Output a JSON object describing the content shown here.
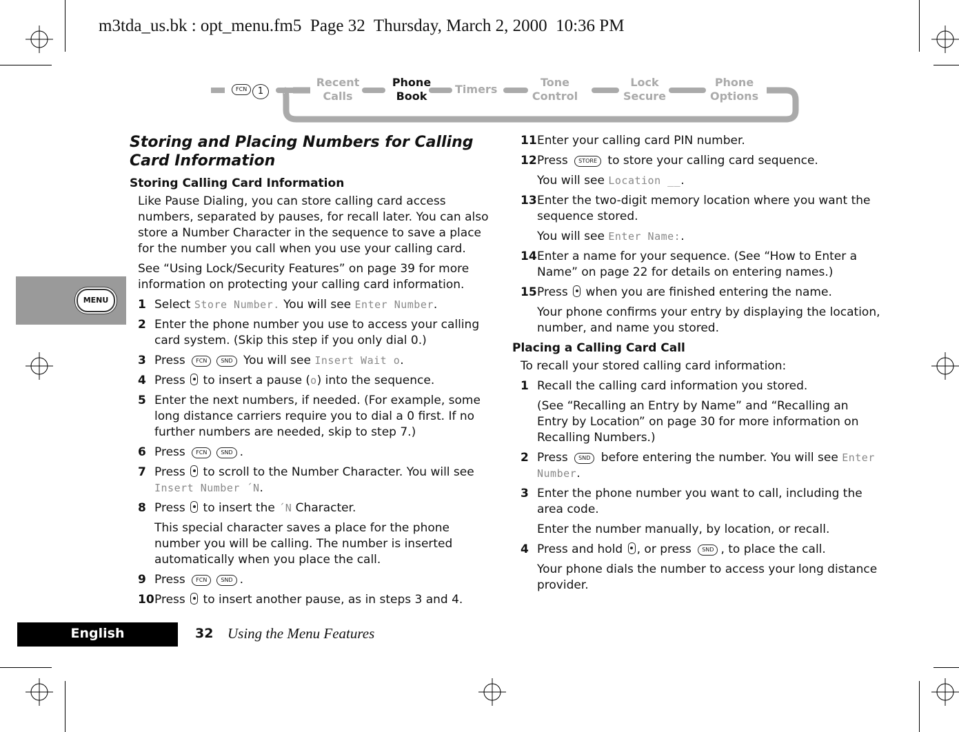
{
  "slug": "m3tda_us.bk : opt_menu.fm5  Page 32  Thursday, March 2, 2000  10:36 PM",
  "nav": {
    "prefix_keys": [
      "FCN",
      "1"
    ],
    "items": [
      {
        "label": "Recent\nCalls",
        "active": false
      },
      {
        "label": "Phone\nBook",
        "active": true
      },
      {
        "label": "Timers",
        "active": false
      },
      {
        "label": "Tone\nControl",
        "active": false
      },
      {
        "label": "Lock\nSecure",
        "active": false
      },
      {
        "label": "Phone\nOptions",
        "active": false
      }
    ]
  },
  "side_tab": {
    "label": "MENU"
  },
  "left": {
    "title": "Storing and Placing Numbers for Calling Card Information",
    "section": "Storing Calling Card Information",
    "intro": [
      "Like Pause Dialing, you can store calling card access numbers, separated by pauses, for recall later. You can also store a Number Character in the sequence to save a place for the number you call when you use your calling card.",
      "See “Using Lock/Security Features” on page 39 for more information on protecting your calling card information."
    ],
    "steps": [
      {
        "n": "1",
        "parts": [
          {
            "t": "Select "
          },
          {
            "lcd": "Store Number."
          },
          {
            "t": " You will see "
          },
          {
            "lcd": "Enter Number"
          },
          {
            "t": "."
          }
        ]
      },
      {
        "n": "2",
        "parts": [
          {
            "t": "Enter the phone number you use to access your calling card system. (Skip this step if you only dial 0.)"
          }
        ]
      },
      {
        "n": "3",
        "parts": [
          {
            "t": "Press "
          },
          {
            "key": "FCN"
          },
          {
            "key": "SND"
          },
          {
            "t": "  You will see "
          },
          {
            "lcd": "Insert Wait o"
          },
          {
            "t": "."
          }
        ]
      },
      {
        "n": "4",
        "parts": [
          {
            "t": "Press "
          },
          {
            "icon": "nav-key"
          },
          {
            "t": " to insert a pause ("
          },
          {
            "lcd": "o"
          },
          {
            "t": ") into the sequence."
          }
        ]
      },
      {
        "n": "5",
        "parts": [
          {
            "t": "Enter the next numbers, if needed. (For example, some long distance carriers require you to dial a 0 first. If no further numbers are needed, skip to step 7.)"
          }
        ]
      },
      {
        "n": "6",
        "parts": [
          {
            "t": "Press "
          },
          {
            "key": "FCN"
          },
          {
            "key": "SND"
          },
          {
            "t": "."
          }
        ]
      },
      {
        "n": "7",
        "parts": [
          {
            "t": "Press "
          },
          {
            "icon": "nav-key"
          },
          {
            "t": " to scroll to the Number Character. You will see "
          },
          {
            "lcd": "Insert Number ´N"
          },
          {
            "t": "."
          }
        ]
      },
      {
        "n": "8",
        "parts": [
          {
            "t": "Press "
          },
          {
            "icon": "nav-key"
          },
          {
            "t": " to insert the "
          },
          {
            "lcd": "´N"
          },
          {
            "t": "  Character."
          }
        ],
        "notes": [
          "This special character saves a place for the phone number you will be calling. The number is inserted automatically when you place the call."
        ]
      },
      {
        "n": "9",
        "parts": [
          {
            "t": "Press "
          },
          {
            "key": "FCN"
          },
          {
            "key": "SND"
          },
          {
            "t": "."
          }
        ]
      },
      {
        "n": "10",
        "parts": [
          {
            "t": "Press "
          },
          {
            "icon": "nav-key"
          },
          {
            "t": " to insert another pause, as in steps 3 and 4."
          }
        ]
      }
    ]
  },
  "right": {
    "steps": [
      {
        "n": "11",
        "parts": [
          {
            "t": "Enter your calling card PIN number."
          }
        ]
      },
      {
        "n": "12",
        "parts": [
          {
            "t": "Press "
          },
          {
            "key": "STORE"
          },
          {
            "t": " to store your calling card sequence."
          }
        ],
        "notes_parts": [
          [
            {
              "t": "You will see "
            },
            {
              "lcd": "Location __"
            },
            {
              "t": "."
            }
          ]
        ]
      },
      {
        "n": "13",
        "parts": [
          {
            "t": "Enter the two-digit memory location where you want the sequence stored."
          }
        ],
        "notes_parts": [
          [
            {
              "t": "You will see "
            },
            {
              "lcd": "Enter Name:"
            },
            {
              "t": "."
            }
          ]
        ]
      },
      {
        "n": "14",
        "parts": [
          {
            "t": "Enter a name for your sequence. (See “How to Enter a Name” on page 22 for details on entering names.)"
          }
        ]
      },
      {
        "n": "15",
        "parts": [
          {
            "t": "Press "
          },
          {
            "icon": "nav-key"
          },
          {
            "t": " when you are finished entering the name."
          }
        ],
        "notes": [
          "Your phone confirms your entry by displaying the location, number, and name you stored."
        ]
      }
    ],
    "section": "Placing a Calling Card Call",
    "intro": "To recall your stored calling card information:",
    "steps2": [
      {
        "n": "1",
        "parts": [
          {
            "t": "Recall the calling card information you stored."
          }
        ],
        "notes": [
          "(See “Recalling an Entry by Name”  and “Recalling an Entry by Location” on page 30 for more information on Recalling Numbers.)"
        ]
      },
      {
        "n": "2",
        "parts": [
          {
            "t": "Press "
          },
          {
            "key": "SND"
          },
          {
            "t": " before entering the number. You will see "
          },
          {
            "lcd": "Enter Number"
          },
          {
            "t": "."
          }
        ]
      },
      {
        "n": "3",
        "parts": [
          {
            "t": "Enter the phone number you want to call, including the area code."
          }
        ],
        "notes": [
          "Enter the number manually, by location, or recall."
        ]
      },
      {
        "n": "4",
        "parts": [
          {
            "t": "Press and hold "
          },
          {
            "icon": "nav-key"
          },
          {
            "t": ", or press "
          },
          {
            "key": "SND"
          },
          {
            "t": ", to place the call."
          }
        ],
        "notes": [
          "Your phone dials the number to access your long distance provider."
        ]
      }
    ]
  },
  "footer": {
    "language": "English",
    "page_number": "32",
    "chapter": "Using the Menu Features"
  }
}
